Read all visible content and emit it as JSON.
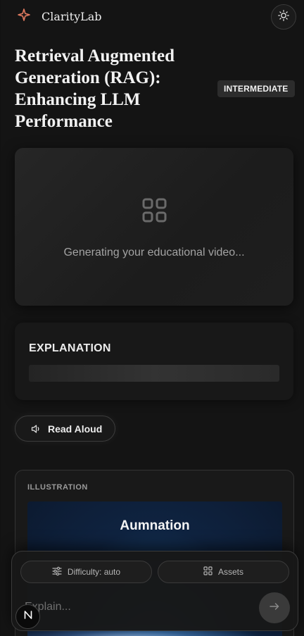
{
  "header": {
    "brand": "ClarityLab",
    "logo_icon": "sparkle-icon",
    "theme_toggle_icon": "sun-icon",
    "accent_color": "#e07a5f"
  },
  "lesson": {
    "title": "Retrieval Augmented Generation (RAG): Enhancing LLM Performance",
    "difficulty_badge": "INTERMEDIATE"
  },
  "video": {
    "icon": "grid-icon",
    "status": "Generating your educational video..."
  },
  "explanation": {
    "heading": "EXPLANATION",
    "loading": true
  },
  "read_aloud": {
    "label": "Read Aloud",
    "icon": "speaker-icon"
  },
  "illustration": {
    "heading": "ILLUSTRATION",
    "image_caption": "Aumnation"
  },
  "input_panel": {
    "difficulty_label": "Difficulty: auto",
    "difficulty_icon": "sliders-icon",
    "assets_label": "Assets",
    "assets_icon": "grid-icon",
    "placeholder": "Explain...",
    "send_icon": "arrow-right-icon"
  },
  "corner_badge": {
    "letter": "N"
  }
}
